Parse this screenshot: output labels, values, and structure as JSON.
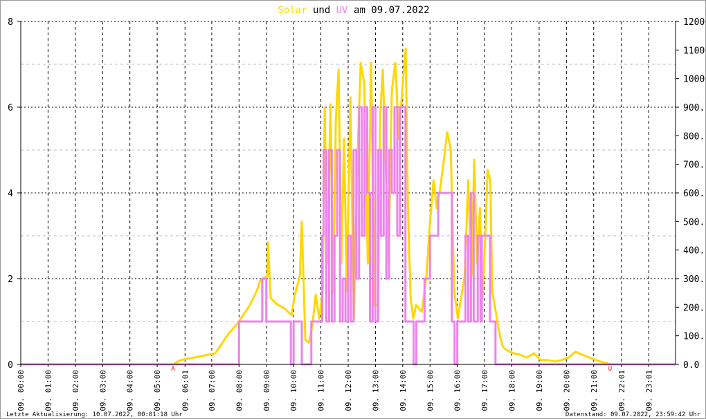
{
  "chart_data": {
    "type": "line",
    "title": {
      "part1": "Solar",
      "part2": "und",
      "part3": "UV",
      "part4": "am 09.07.2022"
    },
    "colors": {
      "solar": "#ffd700",
      "uv": "#ee82ee",
      "marker": "#ff0000"
    },
    "x_range_hours": [
      0,
      24
    ],
    "x_tick_labels": [
      {
        "h": 0,
        "label": "09. 00:00"
      },
      {
        "h": 1,
        "label": "09. 01:00"
      },
      {
        "h": 2,
        "label": "09. 02:00"
      },
      {
        "h": 3,
        "label": "09. 03:00"
      },
      {
        "h": 4,
        "label": "09. 04:00"
      },
      {
        "h": 5,
        "label": "09. 05:00"
      },
      {
        "h": 6.02,
        "label": "09. 06:01"
      },
      {
        "h": 7,
        "label": "09. 07:00"
      },
      {
        "h": 8,
        "label": "09. 08:00"
      },
      {
        "h": 9,
        "label": "09. 09:00"
      },
      {
        "h": 10,
        "label": "09. 10:00"
      },
      {
        "h": 11,
        "label": "09. 11:00"
      },
      {
        "h": 12,
        "label": "09. 12:00"
      },
      {
        "h": 13,
        "label": "09. 13:00"
      },
      {
        "h": 14,
        "label": "09. 14:00"
      },
      {
        "h": 15,
        "label": "09. 15:00"
      },
      {
        "h": 16,
        "label": "09. 16:00"
      },
      {
        "h": 17,
        "label": "09. 17:00"
      },
      {
        "h": 18,
        "label": "09. 18:00"
      },
      {
        "h": 19,
        "label": "09. 19:00"
      },
      {
        "h": 20,
        "label": "09. 20:00"
      },
      {
        "h": 21,
        "label": "09. 21:00"
      },
      {
        "h": 22.02,
        "label": "09. 22:01"
      },
      {
        "h": 23.02,
        "label": "09. 23:01"
      }
    ],
    "y_left": {
      "label": "UV",
      "range": [
        0,
        8
      ],
      "ticks": [
        "0",
        "2",
        "4",
        "6",
        "8"
      ],
      "minor": [
        1,
        3,
        5,
        7
      ]
    },
    "y_right": {
      "label": "Solar",
      "range": [
        0,
        1200
      ],
      "ticks": [
        {
          "v": 0,
          "label": "0.0"
        },
        {
          "v": 100,
          "label": "100.0"
        },
        {
          "v": 200,
          "label": "200.0"
        },
        {
          "v": 300,
          "label": "300.0"
        },
        {
          "v": 400,
          "label": "400.0"
        },
        {
          "v": 500,
          "label": "500.0"
        },
        {
          "v": 600,
          "label": "600.0"
        },
        {
          "v": 700,
          "label": "700.0"
        },
        {
          "v": 800,
          "label": "800.0"
        },
        {
          "v": 900,
          "label": "900.0"
        },
        {
          "v": 1000,
          "label": "1000"
        },
        {
          "v": 1100,
          "label": "1100"
        },
        {
          "v": 1200,
          "label": "1200"
        }
      ]
    },
    "markers": [
      {
        "h": 5.58,
        "label": "A"
      },
      {
        "h": 21.6,
        "label": "U"
      }
    ],
    "series": [
      {
        "name": "Solar",
        "axis": "right",
        "points": [
          [
            0,
            0
          ],
          [
            5.58,
            0
          ],
          [
            5.86,
            15
          ],
          [
            6.62,
            29
          ],
          [
            7.13,
            39
          ],
          [
            7.39,
            75
          ],
          [
            7.64,
            111
          ],
          [
            7.89,
            136
          ],
          [
            8.15,
            172
          ],
          [
            8.4,
            208
          ],
          [
            8.65,
            257
          ],
          [
            8.78,
            293
          ],
          [
            9.04,
            310
          ],
          [
            9.06,
            426
          ],
          [
            9.16,
            232
          ],
          [
            9.42,
            208
          ],
          [
            9.67,
            196
          ],
          [
            9.92,
            172
          ],
          [
            10.05,
            244
          ],
          [
            10.23,
            310
          ],
          [
            10.3,
            499
          ],
          [
            10.43,
            87
          ],
          [
            10.56,
            75
          ],
          [
            10.69,
            136
          ],
          [
            10.81,
            244
          ],
          [
            10.94,
            160
          ],
          [
            11.07,
            257
          ],
          [
            11.14,
            898
          ],
          [
            11.24,
            353
          ],
          [
            11.35,
            910
          ],
          [
            11.45,
            252
          ],
          [
            11.55,
            862
          ],
          [
            11.65,
            1031
          ],
          [
            11.75,
            353
          ],
          [
            11.85,
            789
          ],
          [
            11.95,
            257
          ],
          [
            12.08,
            934
          ],
          [
            12.21,
            160
          ],
          [
            12.34,
            716
          ],
          [
            12.46,
            1055
          ],
          [
            12.59,
            983
          ],
          [
            12.72,
            353
          ],
          [
            12.84,
            1055
          ],
          [
            12.97,
            208
          ],
          [
            13.1,
            208
          ],
          [
            13.17,
            862
          ],
          [
            13.27,
            1031
          ],
          [
            13.35,
            789
          ],
          [
            13.48,
            353
          ],
          [
            13.6,
            958
          ],
          [
            13.73,
            1055
          ],
          [
            13.86,
            789
          ],
          [
            13.98,
            958
          ],
          [
            14.11,
            1104
          ],
          [
            14.19,
            547
          ],
          [
            14.29,
            232
          ],
          [
            14.39,
            160
          ],
          [
            14.49,
            208
          ],
          [
            14.7,
            184
          ],
          [
            14.87,
            310
          ],
          [
            15.0,
            499
          ],
          [
            15.13,
            644
          ],
          [
            15.25,
            547
          ],
          [
            15.38,
            620
          ],
          [
            15.51,
            716
          ],
          [
            15.63,
            813
          ],
          [
            15.76,
            753
          ],
          [
            15.89,
            257
          ],
          [
            16.02,
            160
          ],
          [
            16.14,
            232
          ],
          [
            16.27,
            310
          ],
          [
            16.4,
            644
          ],
          [
            16.52,
            310
          ],
          [
            16.62,
            716
          ],
          [
            16.73,
            353
          ],
          [
            16.83,
            547
          ],
          [
            16.93,
            232
          ],
          [
            17.03,
            454
          ],
          [
            17.11,
            680
          ],
          [
            17.21,
            644
          ],
          [
            17.28,
            257
          ],
          [
            17.41,
            184
          ],
          [
            17.54,
            111
          ],
          [
            17.66,
            63
          ],
          [
            17.79,
            51
          ],
          [
            18.05,
            39
          ],
          [
            18.3,
            34
          ],
          [
            18.55,
            24
          ],
          [
            18.81,
            39
          ],
          [
            19.06,
            15
          ],
          [
            19.31,
            15
          ],
          [
            19.57,
            10
          ],
          [
            19.82,
            15
          ],
          [
            20.08,
            24
          ],
          [
            20.33,
            44
          ],
          [
            20.58,
            34
          ],
          [
            20.84,
            24
          ],
          [
            21.09,
            15
          ],
          [
            21.35,
            7
          ],
          [
            21.6,
            0
          ],
          [
            24,
            0
          ]
        ]
      },
      {
        "name": "UV",
        "axis": "left",
        "step": true,
        "points": [
          [
            0,
            0
          ],
          [
            7.95,
            0
          ],
          [
            8.0,
            1
          ],
          [
            8.85,
            2
          ],
          [
            9.0,
            1
          ],
          [
            9.9,
            0
          ],
          [
            10.0,
            1
          ],
          [
            10.3,
            0
          ],
          [
            10.65,
            1
          ],
          [
            11.0,
            1
          ],
          [
            11.05,
            3
          ],
          [
            11.1,
            5
          ],
          [
            11.2,
            1
          ],
          [
            11.3,
            5
          ],
          [
            11.4,
            1
          ],
          [
            11.5,
            3
          ],
          [
            11.6,
            5
          ],
          [
            11.7,
            1
          ],
          [
            11.8,
            2
          ],
          [
            11.9,
            1
          ],
          [
            12.0,
            3
          ],
          [
            12.1,
            1
          ],
          [
            12.2,
            5
          ],
          [
            12.3,
            2
          ],
          [
            12.4,
            6
          ],
          [
            12.5,
            3
          ],
          [
            12.6,
            6
          ],
          [
            12.7,
            4
          ],
          [
            12.8,
            1
          ],
          [
            12.9,
            6
          ],
          [
            13.0,
            1
          ],
          [
            13.1,
            5
          ],
          [
            13.2,
            3
          ],
          [
            13.3,
            6
          ],
          [
            13.4,
            2
          ],
          [
            13.5,
            5
          ],
          [
            13.6,
            4
          ],
          [
            13.7,
            6
          ],
          [
            13.8,
            3
          ],
          [
            13.9,
            6
          ],
          [
            14.0,
            6
          ],
          [
            14.1,
            1
          ],
          [
            14.4,
            0
          ],
          [
            14.5,
            1
          ],
          [
            14.8,
            2
          ],
          [
            15.0,
            3
          ],
          [
            15.3,
            4
          ],
          [
            15.8,
            1
          ],
          [
            15.9,
            0
          ],
          [
            16.0,
            1
          ],
          [
            16.3,
            3
          ],
          [
            16.4,
            1
          ],
          [
            16.5,
            4
          ],
          [
            16.6,
            1
          ],
          [
            16.75,
            3
          ],
          [
            16.85,
            1
          ],
          [
            16.9,
            3
          ],
          [
            17.2,
            1
          ],
          [
            17.4,
            0
          ],
          [
            24,
            0
          ]
        ]
      }
    ],
    "grid": true
  },
  "footer": {
    "left": "Letzte Aktualisierung: 10.07.2022, 00:01:18 Uhr",
    "right": "Datenstand: 09.07.2022, 23:59:42 Uhr"
  }
}
